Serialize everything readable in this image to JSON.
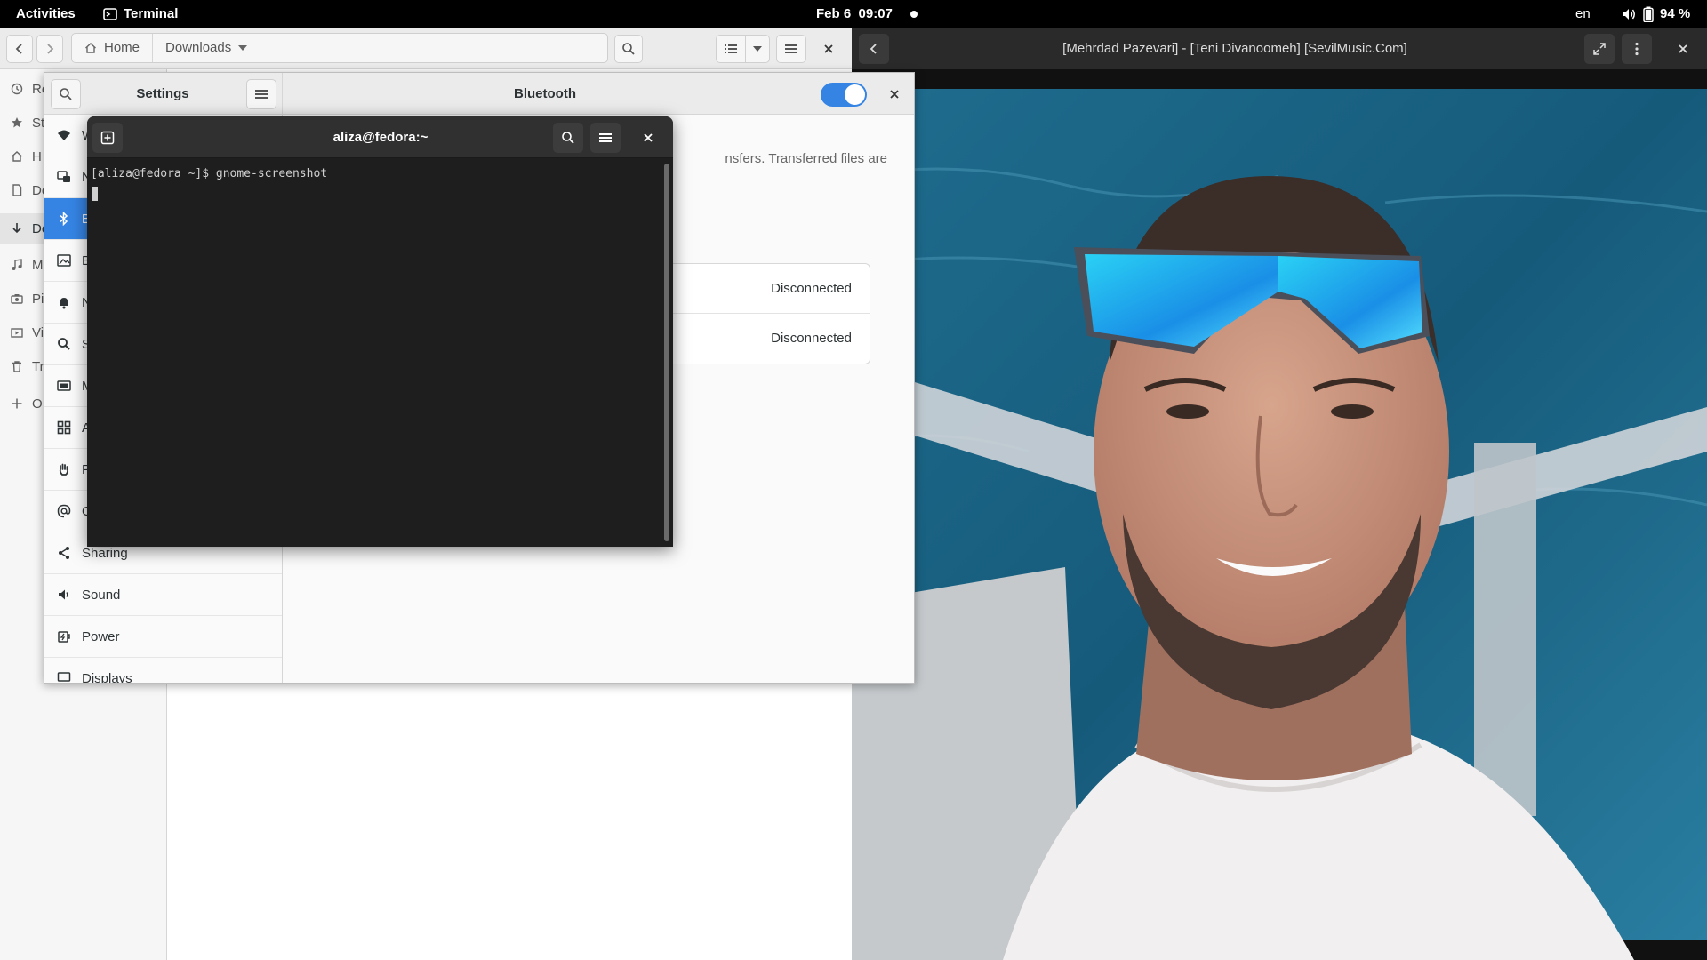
{
  "topbar": {
    "activities": "Activities",
    "app_name": "Terminal",
    "clock": "Feb 6  09:07",
    "keyboard_layout": "en",
    "battery": "94 %"
  },
  "files": {
    "path": [
      "Home",
      "Downloads"
    ],
    "sidebar_items": [
      {
        "label": "Re",
        "icon": "clock-icon"
      },
      {
        "label": "St",
        "icon": "star-icon"
      },
      {
        "label": "H",
        "icon": "home-icon"
      },
      {
        "label": "Do",
        "icon": "document-icon"
      },
      {
        "label": "Do",
        "icon": "download-icon"
      },
      {
        "label": "M",
        "icon": "music-icon"
      },
      {
        "label": "Pi",
        "icon": "camera-icon"
      },
      {
        "label": "Vi",
        "icon": "video-icon"
      },
      {
        "label": "Tr",
        "icon": "trash-icon"
      },
      {
        "label": "O",
        "icon": "plus-icon"
      }
    ]
  },
  "video": {
    "title": "[Mehrdad Pazevari] - [Teni Divanoomeh] [SevilMusic.Com]"
  },
  "settings": {
    "title": "Settings",
    "panel_title": "Bluetooth",
    "bluetooth_enabled": true,
    "description": "nsfers. Transferred files are",
    "sidebar": [
      {
        "label": "W",
        "icon": "wifi-icon",
        "active": false
      },
      {
        "label": "N",
        "icon": "network-icon",
        "active": false
      },
      {
        "label": "B",
        "icon": "bluetooth-icon",
        "active": true
      },
      {
        "label": "B",
        "icon": "background-icon",
        "active": false
      },
      {
        "label": "N",
        "icon": "bell-icon",
        "active": false
      },
      {
        "label": "S",
        "icon": "search-icon",
        "active": false
      },
      {
        "label": "M",
        "icon": "multitasking-icon",
        "active": false
      },
      {
        "label": "A",
        "icon": "apps-icon",
        "active": false
      },
      {
        "label": "P",
        "icon": "hand-icon",
        "active": false
      },
      {
        "label": "O",
        "icon": "at-icon",
        "active": false
      },
      {
        "label": "Sharing",
        "icon": "share-icon",
        "active": false
      },
      {
        "label": "Sound",
        "icon": "speaker-icon",
        "active": false
      },
      {
        "label": "Power",
        "icon": "power-icon",
        "active": false
      },
      {
        "label": "Displays",
        "icon": "display-icon",
        "active": false
      }
    ],
    "devices": [
      {
        "name": "",
        "status": "Disconnected"
      },
      {
        "name": "",
        "status": "Disconnected"
      }
    ]
  },
  "terminal": {
    "title": "aliza@fedora:~",
    "prompt": "[aliza@fedora ~]$ gnome-screenshot"
  }
}
